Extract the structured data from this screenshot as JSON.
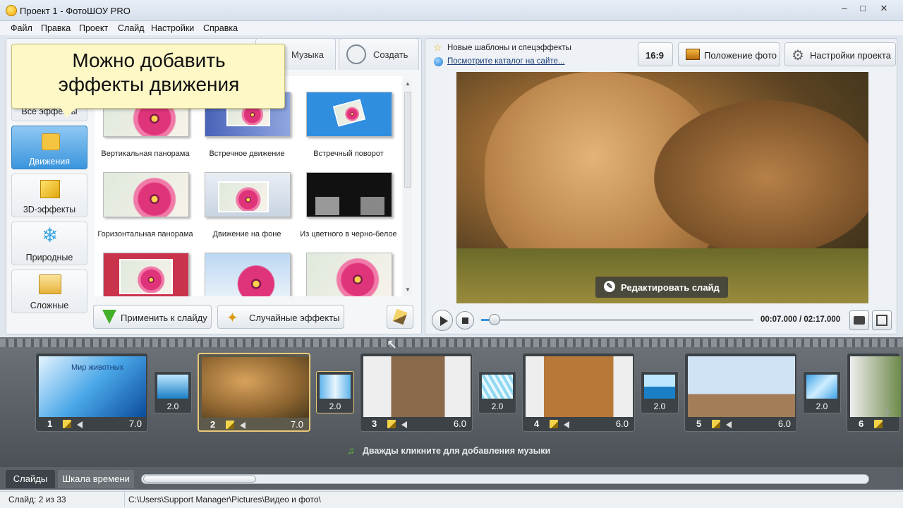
{
  "window": {
    "title": "Проект 1 - ФотоШОУ PRO"
  },
  "menu": [
    "Файл",
    "Правка",
    "Проект",
    "Слайд",
    "Настройки",
    "Справка"
  ],
  "tabs": {
    "music": "Музыка",
    "create": "Создать"
  },
  "tooltip": {
    "line1": "Можно добавить",
    "line2": "эффекты движения"
  },
  "categories": [
    {
      "label": "Все эффекты"
    },
    {
      "label": "Движения"
    },
    {
      "label": "3D-эффекты"
    },
    {
      "label": "Природные"
    },
    {
      "label": "Сложные"
    }
  ],
  "effects": [
    "Вертикальная панорама",
    "Встречное движение",
    "Встречный поворот",
    "Горизонтальная панорама",
    "Движение на фоне",
    "Из цветного в черно-белое",
    "",
    "",
    ""
  ],
  "actions": {
    "apply": "Применить к слайду",
    "random": "Случайные эффекты"
  },
  "news": {
    "line1": "Новые шаблоны и спецэффекты",
    "link": "Посмотрите каталог на сайте..."
  },
  "toolbar": {
    "ratio": "16:9",
    "photo_position": "Положение фото",
    "project_settings": "Настройки проекта"
  },
  "preview": {
    "edit_slide": "Редактировать слайд"
  },
  "player": {
    "time": "00:07.000 / 02:17.000",
    "progress": 0.05
  },
  "slides": [
    {
      "num": "1",
      "dur": "7.0",
      "caption": "Мир животных"
    },
    {
      "num": "2",
      "dur": "7.0"
    },
    {
      "num": "3",
      "dur": "6.0"
    },
    {
      "num": "4",
      "dur": "6.0"
    },
    {
      "num": "5",
      "dur": "6.0"
    },
    {
      "num": "6",
      "dur": ""
    }
  ],
  "transitions": [
    "2.0",
    "2.0",
    "2.0",
    "2.0",
    "2.0"
  ],
  "music_hint": "Дважды кликните для добавления музыки",
  "bottom_tabs": {
    "slides": "Слайды",
    "timeline": "Шкала времени"
  },
  "status": {
    "slide": "Слайд: 2 из 33",
    "path": "C:\\Users\\Support Manager\\Pictures\\Видео и фото\\"
  },
  "colors": {
    "accent": "#3a95dd",
    "selected_border": "#e8c97a",
    "tooltip_bg": "#fdf8c6"
  }
}
